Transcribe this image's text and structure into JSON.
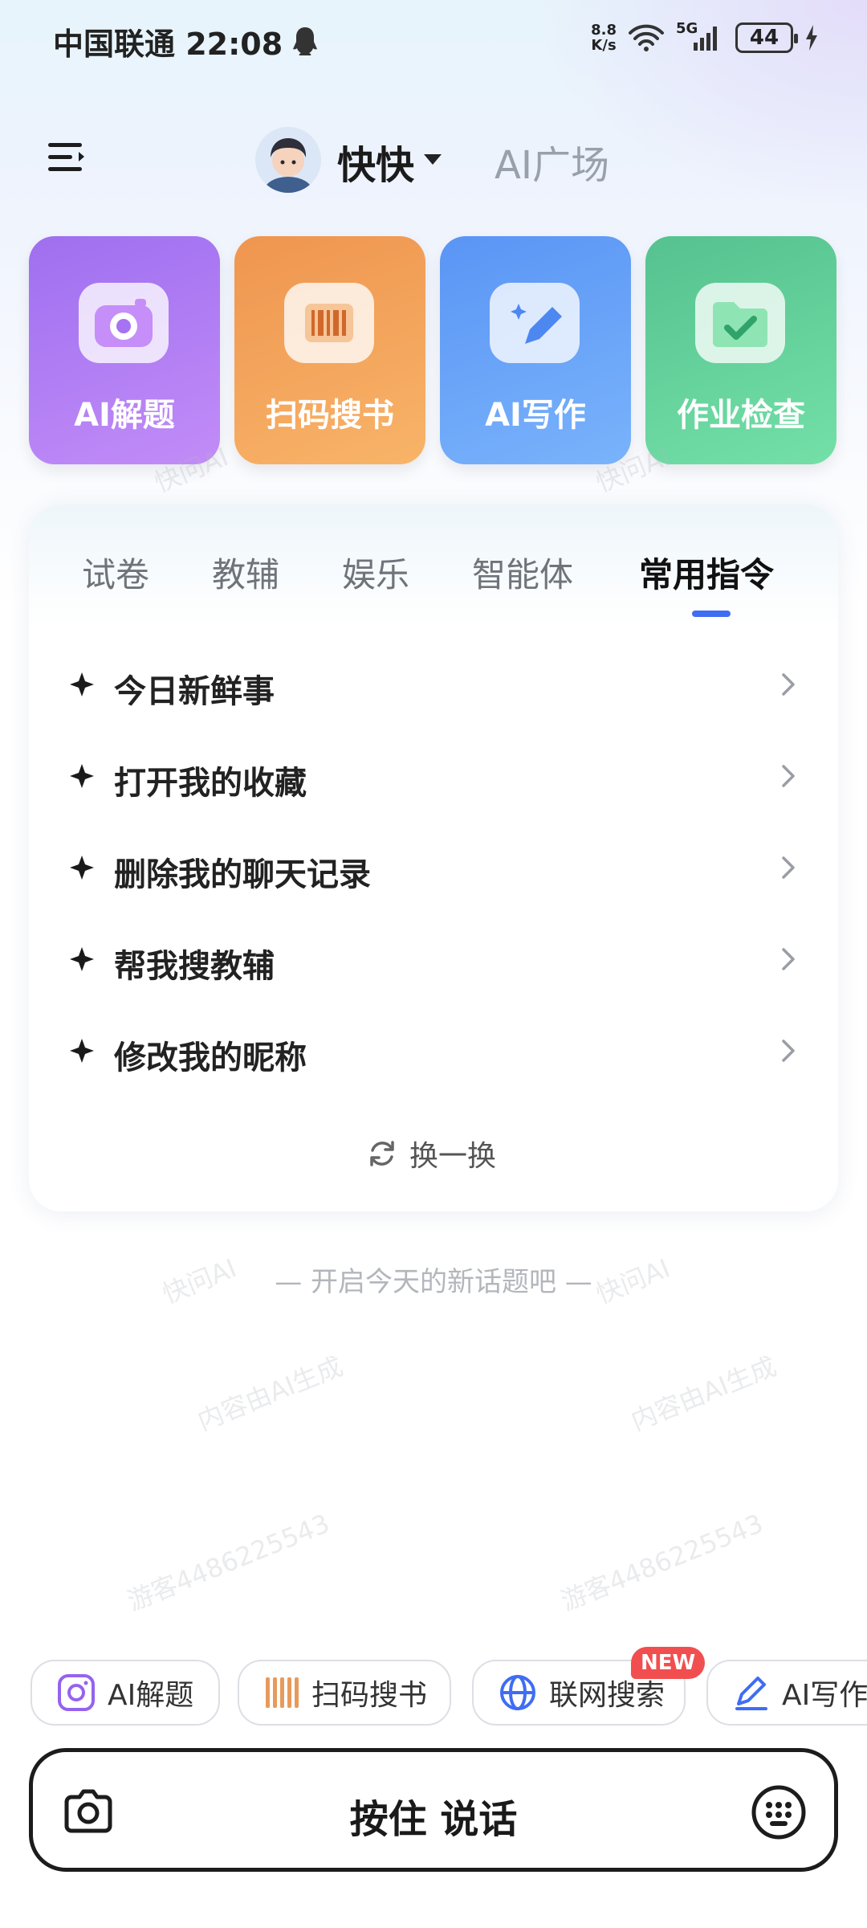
{
  "status_bar": {
    "carrier_time": "中国联通 22:08",
    "net_speed_top": "8.8",
    "net_speed_bottom": "K/s",
    "signal_label": "5G",
    "battery": "44"
  },
  "header": {
    "user_name": "快快",
    "ai_square": "AI广场"
  },
  "feature_cards": [
    {
      "label": "AI解题",
      "icon": "camera-icon",
      "color": "#a678f3"
    },
    {
      "label": "扫码搜书",
      "icon": "barcode-icon",
      "color": "#f39d56"
    },
    {
      "label": "AI写作",
      "icon": "pen-icon",
      "color": "#639ff7"
    },
    {
      "label": "作业检查",
      "icon": "folder-check-icon",
      "color": "#5ccb95"
    }
  ],
  "tabs": [
    {
      "label": "试卷"
    },
    {
      "label": "教辅"
    },
    {
      "label": "娱乐"
    },
    {
      "label": "智能体"
    },
    {
      "label": "常用指令",
      "active": true
    }
  ],
  "commands": [
    {
      "label": "今日新鲜事"
    },
    {
      "label": "打开我的收藏"
    },
    {
      "label": "删除我的聊天记录"
    },
    {
      "label": "帮我搜教辅"
    },
    {
      "label": "修改我的昵称"
    }
  ],
  "refresh_label": "换一换",
  "topic_hint": "— 开启今天的新话题吧 —",
  "watermarks": {
    "app": "快问AI",
    "ai_generated": "内容由AI生成",
    "guest": "游客4486225543"
  },
  "chips": [
    {
      "label": "AI解题",
      "icon": "camera-icon"
    },
    {
      "label": "扫码搜书",
      "icon": "barcode-icon"
    },
    {
      "label": "联网搜索",
      "icon": "globe-icon",
      "badge": "NEW"
    },
    {
      "label": "AI写作",
      "icon": "pen-icon"
    }
  ],
  "input_bar": {
    "talk_label": "按住 说话"
  },
  "colors": {
    "accent": "#3f6df3",
    "badge": "#f14f4f"
  }
}
